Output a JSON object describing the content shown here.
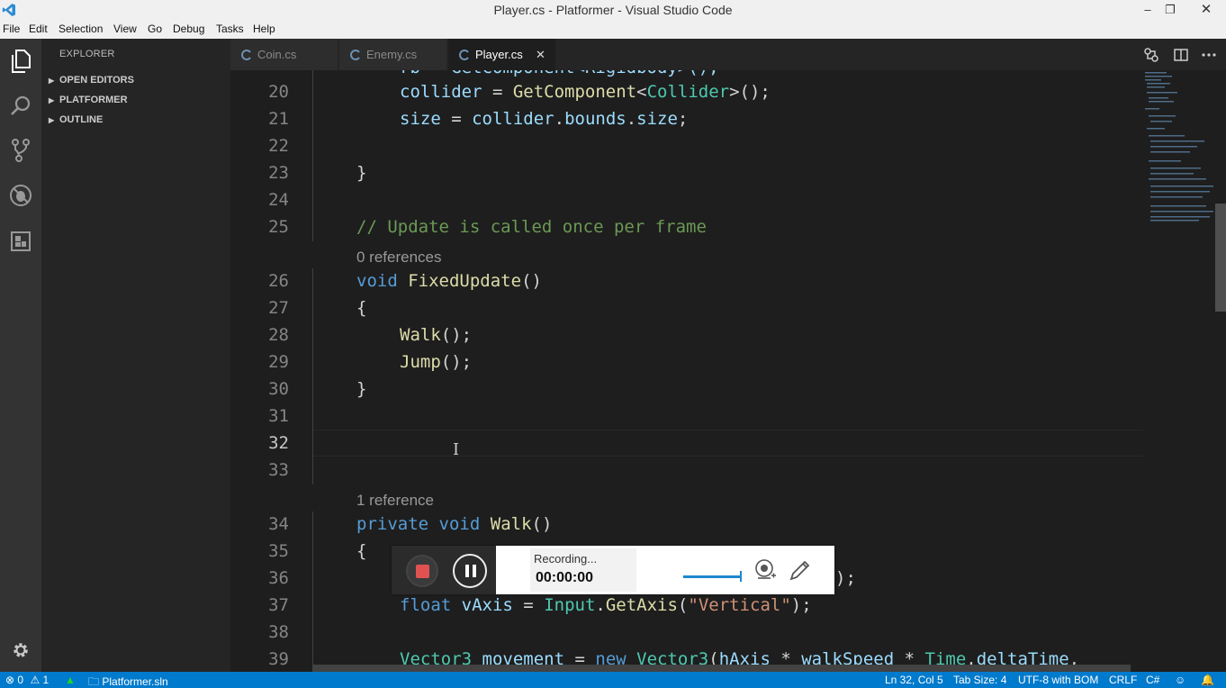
{
  "window": {
    "title": "Player.cs - Platformer - Visual Studio Code",
    "minimize": "–",
    "restore": "❐",
    "close": "✕"
  },
  "menu": [
    {
      "label": "File"
    },
    {
      "label": "Edit"
    },
    {
      "label": "Selection"
    },
    {
      "label": "View"
    },
    {
      "label": "Go"
    },
    {
      "label": "Debug"
    },
    {
      "label": "Tasks"
    },
    {
      "label": "Help"
    }
  ],
  "activity_bar": {
    "items": [
      "files-icon",
      "search-icon",
      "source-control-icon",
      "debug-icon",
      "extensions-icon"
    ],
    "bottom": "settings-gear-icon"
  },
  "sidebar": {
    "title": "EXPLORER",
    "sections": [
      {
        "label": "OPEN EDITORS"
      },
      {
        "label": "PLATFORMER"
      },
      {
        "label": "OUTLINE"
      }
    ]
  },
  "tabs": [
    {
      "label": "Coin.cs",
      "active": false
    },
    {
      "label": "Enemy.cs",
      "active": false
    },
    {
      "label": "Player.cs",
      "active": true,
      "close": "✕"
    }
  ],
  "editor": {
    "current_line": 32,
    "lines": [
      {
        "n": "20",
        "code": "collider = GetComponent<Collider>();"
      },
      {
        "n": "21",
        "code": "size = collider.bounds.size;"
      },
      {
        "n": "22",
        "code": ""
      },
      {
        "n": "23",
        "code": "}"
      },
      {
        "n": "24",
        "code": ""
      },
      {
        "n": "25",
        "code": "// Update is called once per frame"
      },
      {
        "n": "26",
        "code": "void FixedUpdate()"
      },
      {
        "n": "27",
        "code": "{"
      },
      {
        "n": "28",
        "code": "Walk();"
      },
      {
        "n": "29",
        "code": "Jump();"
      },
      {
        "n": "30",
        "code": "}"
      },
      {
        "n": "31",
        "code": ""
      },
      {
        "n": "32",
        "code": ""
      },
      {
        "n": "33",
        "code": ""
      },
      {
        "n": "34",
        "code": "private void Walk()"
      },
      {
        "n": "35",
        "code": "{"
      },
      {
        "n": "36",
        "code": ");"
      },
      {
        "n": "37",
        "code": "float vAxis = Input.GetAxis(\"Vertical\");"
      },
      {
        "n": "38",
        "code": ""
      },
      {
        "n": "39",
        "code": "Vector3 movement = new Vector3(hAxis * walkSpeed * Time.deltaTime,"
      }
    ],
    "codelens": [
      {
        "before_line": "26",
        "text": "0 references"
      },
      {
        "before_line": "34",
        "text": "1 reference"
      }
    ]
  },
  "recorder": {
    "status": "Recording...",
    "time": "00:00:00"
  },
  "statusbar": {
    "errors": "0",
    "warnings": "1",
    "project": "Platformer.sln",
    "position": "Ln 32, Col 5",
    "tab_size": "Tab Size: 4",
    "encoding": "UTF-8 with BOM",
    "eol": "CRLF",
    "language": "C#"
  }
}
